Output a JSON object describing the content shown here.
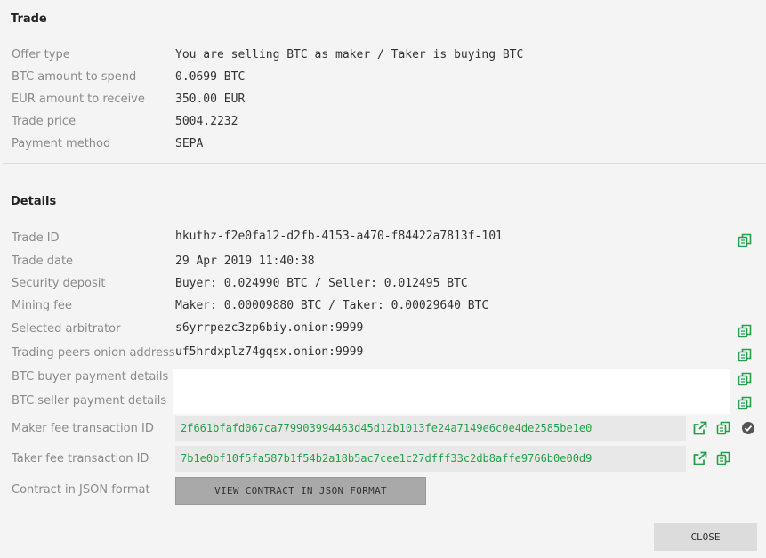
{
  "trade": {
    "title": "Trade",
    "rows": [
      {
        "label": "Offer type",
        "value": "You are selling BTC as maker / Taker is buying BTC"
      },
      {
        "label": "BTC amount to spend",
        "value": "0.0699 BTC"
      },
      {
        "label": "EUR amount to receive",
        "value": "350.00 EUR"
      },
      {
        "label": "Trade price",
        "value": "5004.2232"
      },
      {
        "label": "Payment method",
        "value": "SEPA"
      }
    ]
  },
  "details": {
    "title": "Details",
    "trade_id": {
      "label": "Trade ID",
      "value": "hkuthz-f2e0fa12-d2fb-4153-a470-f84422a7813f-101"
    },
    "trade_date": {
      "label": "Trade date",
      "value": "29 Apr 2019 11:40:38"
    },
    "security_deposit": {
      "label": "Security deposit",
      "value": "Buyer: 0.024990 BTC / Seller: 0.012495 BTC"
    },
    "mining_fee": {
      "label": "Mining fee",
      "value": "Maker: 0.00009880 BTC / Taker: 0.00029640 BTC"
    },
    "arbitrator": {
      "label": "Selected arbitrator",
      "value": "s6yrrpezc3zp6biy.onion:9999"
    },
    "peers_onion": {
      "label": "Trading peers onion address",
      "value": "uf5hrdxplz74gqsx.onion:9999"
    },
    "buyer_payment": {
      "label": "BTC buyer payment details",
      "value": ""
    },
    "seller_payment": {
      "label": "BTC seller payment details",
      "value": ""
    },
    "maker_fee_tx": {
      "label": "Maker fee transaction ID",
      "value": "2f661bfafd067ca779903994463d45d12b1013fe24a7149e6c0e4de2585be1e0"
    },
    "taker_fee_tx": {
      "label": "Taker fee transaction ID",
      "value": "7b1e0bf10f5fa587b1f54b2a18b5ac7cee1c27dfff33c2db8affe9766b0e00d9"
    },
    "contract": {
      "label": "Contract in JSON format",
      "button": "VIEW CONTRACT IN JSON FORMAT"
    }
  },
  "footer": {
    "close_label": "CLOSE"
  },
  "colors": {
    "accent": "#25a04a",
    "confirmed": "#555555"
  },
  "icons": {
    "copy": "copy-icon",
    "external": "external-link-icon",
    "confirmed": "check-circle-icon"
  }
}
